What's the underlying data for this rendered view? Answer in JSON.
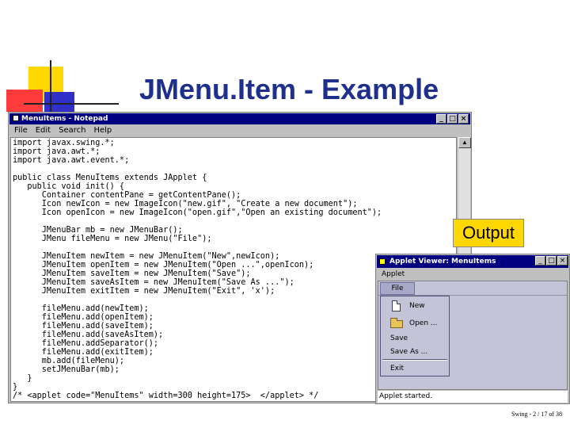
{
  "slide": {
    "title": "JMenu.Item - Example",
    "output_label": "Output",
    "footer": "Swing - 2 / 17 of 38"
  },
  "notepad": {
    "title": "MenuItems - Notepad",
    "menu": [
      "File",
      "Edit",
      "Search",
      "Help"
    ],
    "code_lines": [
      "import javax.swing.*;",
      "import java.awt.*;",
      "import java.awt.event.*;",
      "",
      "public class MenuItems extends JApplet {",
      "   public void init() {",
      "      Container contentPane = getContentPane();",
      "      Icon newIcon = new ImageIcon(\"new.gif\", \"Create a new document\");",
      "      Icon openIcon = new ImageIcon(\"open.gif\",\"Open an existing document\");",
      "",
      "      JMenuBar mb = new JMenuBar();",
      "      JMenu fileMenu = new JMenu(\"File\");",
      "",
      "      JMenuItem newItem = new JMenuItem(\"New\",newIcon);",
      "      JMenuItem openItem = new JMenuItem(\"Open ...\",openIcon);",
      "      JMenuItem saveItem = new JMenuItem(\"Save\");",
      "      JMenuItem saveAsItem = new JMenuItem(\"Save As ...\");",
      "      JMenuItem exitItem = new JMenuItem(\"Exit\", 'x');",
      "",
      "      fileMenu.add(newItem);",
      "      fileMenu.add(openItem);",
      "      fileMenu.add(saveItem);",
      "      fileMenu.add(saveAsItem);",
      "      fileMenu.addSeparator();",
      "      fileMenu.add(exitItem);",
      "      mb.add(fileMenu);",
      "      setJMenuBar(mb);",
      "   }",
      "}",
      "/* <applet code=\"MenuItems\" width=300 height=175>  </applet> */"
    ]
  },
  "applet": {
    "title": "Applet Viewer: MenuItems",
    "menu": "Applet",
    "file_menu": "File",
    "items": {
      "new": "New",
      "open": "Open ...",
      "save": "Save",
      "save_as": "Save As ...",
      "exit": "Exit"
    },
    "status": "Applet started."
  },
  "icons": [
    "document-icon",
    "folder-icon",
    "minimize-icon",
    "maximize-icon",
    "close-icon"
  ]
}
